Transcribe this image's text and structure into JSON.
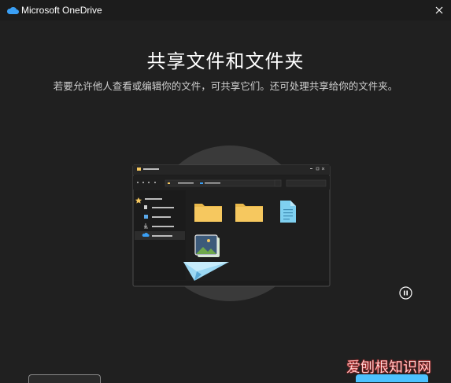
{
  "window": {
    "title": "Microsoft OneDrive",
    "icon": "onedrive-cloud-icon",
    "close_icon": "close-icon"
  },
  "main": {
    "heading": "共享文件和文件夹",
    "subheading": "若要允许他人查看或编辑你的文件，可共享它们。还可处理共享给你的文件夹。"
  },
  "illustration": {
    "icons": [
      "folder-icon",
      "folder-icon",
      "document-icon",
      "image-stack-icon",
      "paper-plane-icon"
    ]
  },
  "controls": {
    "pause_icon": "pause-icon"
  },
  "watermark": {
    "text": "爱刨根知识网"
  },
  "colors": {
    "background": "#202020",
    "accent": "#4cc2ff",
    "folder": "#f6c85f"
  }
}
